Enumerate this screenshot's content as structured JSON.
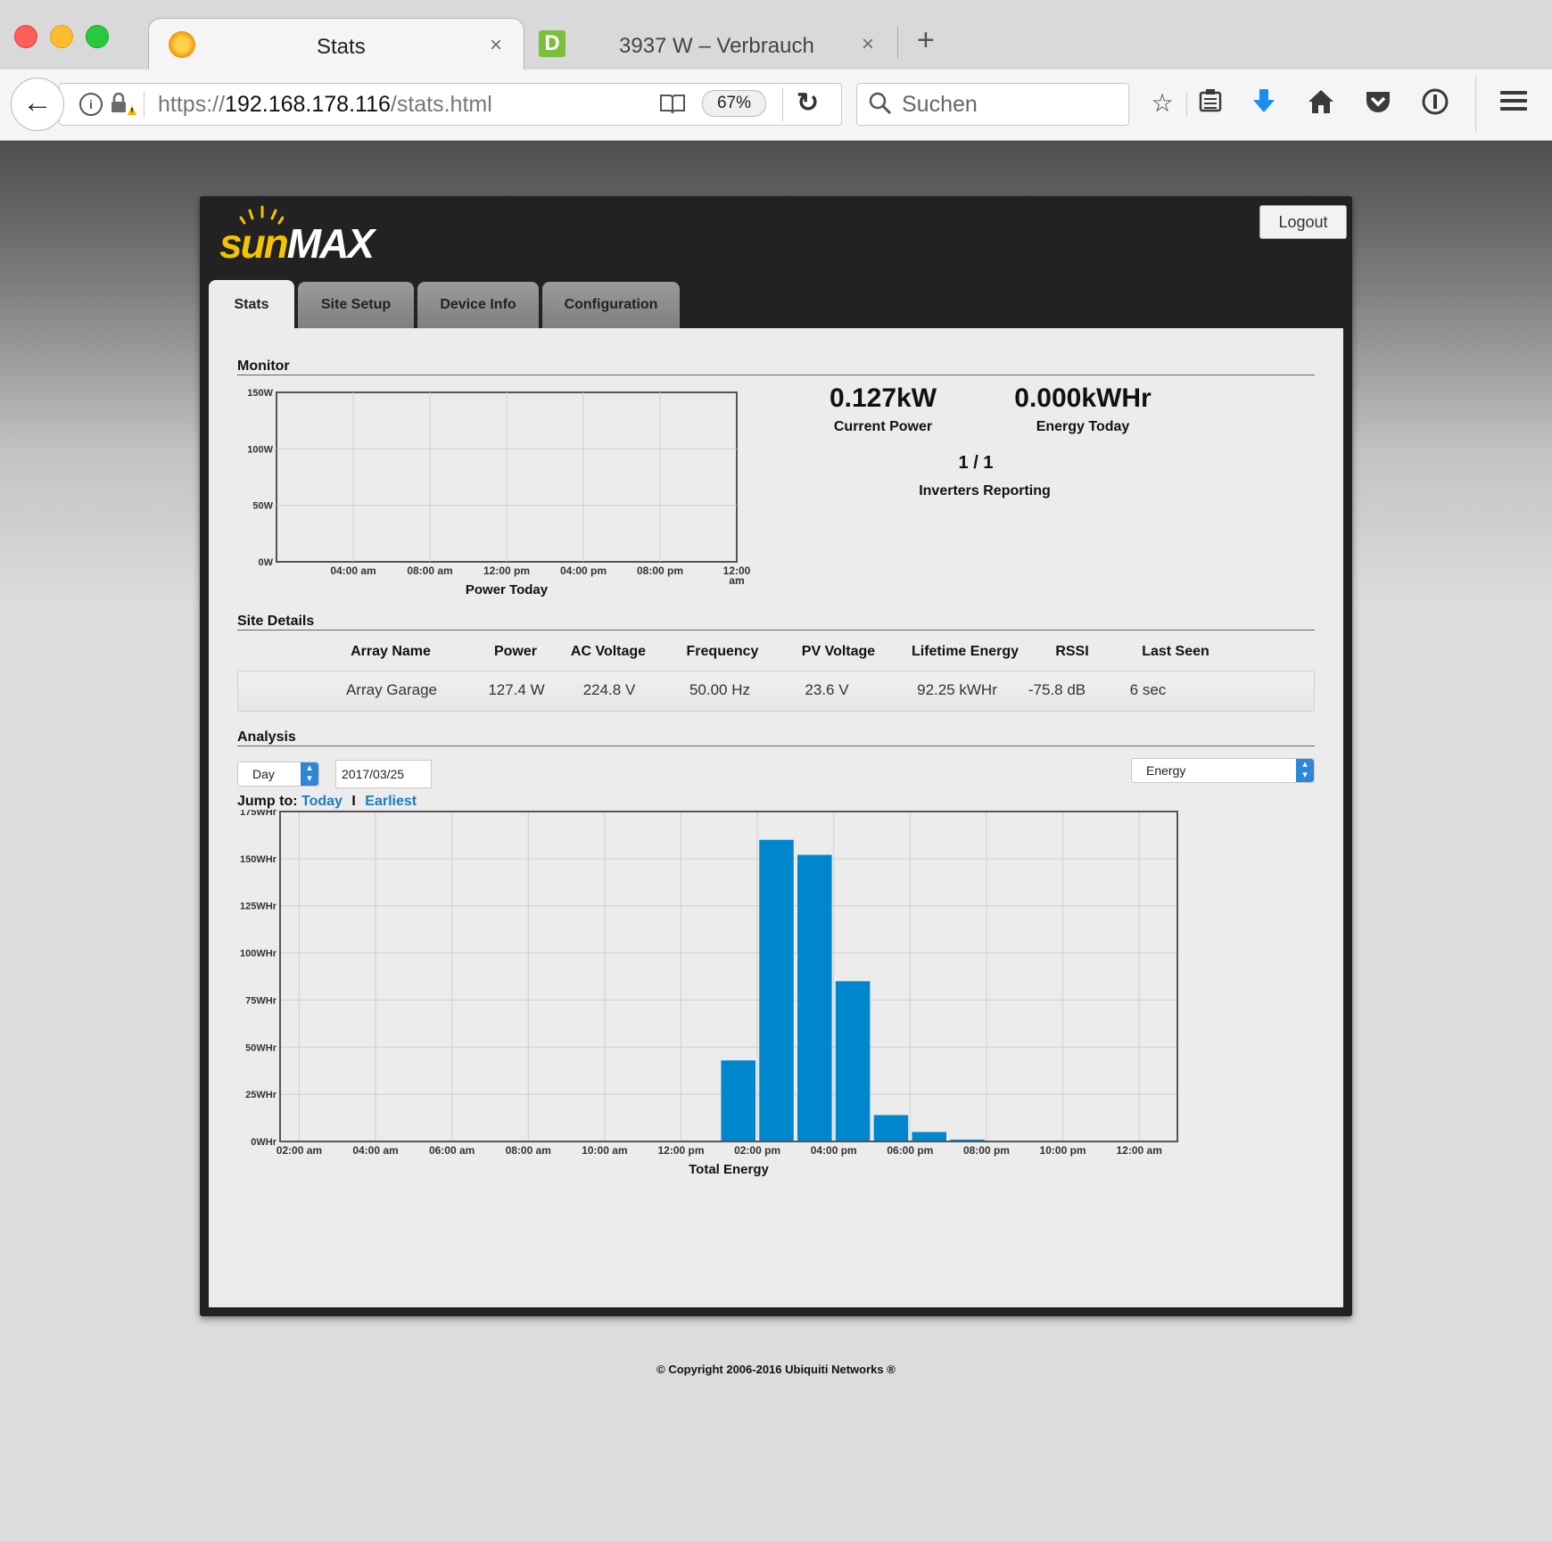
{
  "browser": {
    "tabs": [
      {
        "title": "Stats",
        "close": "×"
      },
      {
        "title": "3937 W – Verbrauch",
        "close": "×",
        "favicon_letter": "D"
      }
    ],
    "new_tab": "+",
    "url_scheme": "https://",
    "url_host": "192.168.178.116",
    "url_path": "/stats.html",
    "zoom": "67%",
    "search_placeholder": "Suchen"
  },
  "app": {
    "logo_sun": "sun",
    "logo_max": "MAX",
    "logout": "Logout",
    "tabs": [
      "Stats",
      "Site Setup",
      "Device Info",
      "Configuration"
    ],
    "active_tab": "Stats"
  },
  "monitor": {
    "title": "Monitor",
    "current_power": {
      "value": "0.127kW",
      "label": "Current Power"
    },
    "energy_today": {
      "value": "0.000kWHr",
      "label": "Energy Today"
    },
    "inverters": {
      "value": "1 / 1",
      "label": "Inverters Reporting"
    }
  },
  "site_details": {
    "title": "Site Details",
    "columns": [
      "Array Name",
      "Power",
      "AC Voltage",
      "Frequency",
      "PV Voltage",
      "Lifetime Energy",
      "RSSI",
      "Last Seen"
    ],
    "rows": [
      [
        "Array Garage",
        "127.4 W",
        "224.8 V",
        "50.00 Hz",
        "23.6 V",
        "92.25 kWHr",
        "-75.8 dB",
        "6 sec"
      ]
    ]
  },
  "analysis": {
    "title": "Analysis",
    "period": "Day",
    "date": "2017/03/25",
    "metric": "Energy",
    "jump_to_label": "Jump to:",
    "jump_today": "Today",
    "jump_separator": "I",
    "jump_earliest": "Earliest"
  },
  "footer": {
    "copyright": "© Copyright 2006-2016 Ubiquiti Networks ®"
  },
  "colors": {
    "bar": "#0086cc",
    "link": "#1a7cc0",
    "logo_yellow": "#f3c400"
  },
  "chart_data": [
    {
      "type": "line",
      "title": "",
      "xlabel": "Power Today",
      "ylabel": "",
      "yticks": [
        "0W",
        "50W",
        "100W",
        "150W"
      ],
      "ylim": [
        0,
        150
      ],
      "xticks": [
        "04:00 am",
        "08:00 am",
        "12:00 pm",
        "04:00 pm",
        "08:00 pm",
        "12:00 am"
      ],
      "series": [],
      "grid": true
    },
    {
      "type": "bar",
      "title": "",
      "xlabel": "Total Energy",
      "ylabel": "",
      "yticks": [
        "0WHr",
        "25WHr",
        "50WHr",
        "75WHr",
        "100WHr",
        "125WHr",
        "150WHr",
        "175WHr"
      ],
      "ylim": [
        0,
        175
      ],
      "xticks": [
        "02:00 am",
        "04:00 am",
        "06:00 am",
        "08:00 am",
        "10:00 am",
        "12:00 pm",
        "02:00 pm",
        "04:00 pm",
        "06:00 pm",
        "08:00 pm",
        "10:00 pm",
        "12:00 am"
      ],
      "categories": [
        "01:00 pm",
        "02:00 pm",
        "03:00 pm",
        "04:00 pm",
        "05:00 pm",
        "06:00 pm",
        "07:00 pm"
      ],
      "category_hours": [
        13,
        14,
        15,
        16,
        17,
        18,
        19
      ],
      "values": [
        43,
        160,
        152,
        85,
        14,
        5,
        1
      ],
      "grid": true
    }
  ]
}
